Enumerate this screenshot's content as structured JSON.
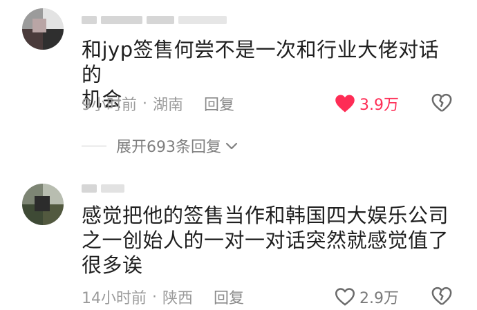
{
  "comments": [
    {
      "text_line1": "和jyp签售何尝不是一次和行业大佬对话的",
      "text_line2": "机会",
      "time": "9小时前",
      "dot": "·",
      "location": "湖南",
      "reply_label": "回复",
      "likes": "3.9万",
      "liked": true,
      "expand_label": "展开693条回复"
    },
    {
      "text_line1": "感觉把他的签售当作和韩国四大娱乐公司",
      "text_line2": "之一创始人的一对一对话突然就感觉值了",
      "text_line3": "很多诶",
      "time": "14小时前",
      "dot": "·",
      "location": "陕西",
      "reply_label": "回复",
      "likes": "2.9万",
      "liked": false
    }
  ],
  "colors": {
    "like_red": "#fe2c55",
    "meta_gray": "#9a9a9a",
    "text": "#1f1f1f"
  },
  "icons": [
    "heart-icon",
    "broken-heart-icon",
    "chevron-down-icon"
  ]
}
